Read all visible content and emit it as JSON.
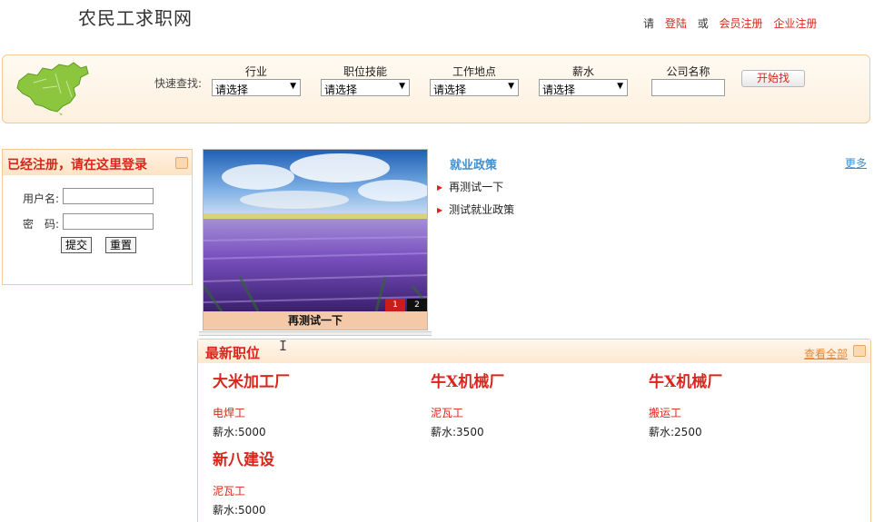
{
  "header": {
    "site_title": "农民工求职网",
    "prompt_text": "请",
    "login_link": "登陆",
    "or_text": "或",
    "member_register_link": "会员注册",
    "company_register_link": "企业注册"
  },
  "search": {
    "quick_label": "快速查找:",
    "fields": [
      {
        "label": "行业",
        "value": "请选择"
      },
      {
        "label": "职位技能",
        "value": "请选择"
      },
      {
        "label": "工作地点",
        "value": "请选择"
      },
      {
        "label": "薪水",
        "value": "请选择"
      }
    ],
    "company_label": "公司名称",
    "company_value": "",
    "button_label": "开始找"
  },
  "login": {
    "title": "已经注册，请在这里登录",
    "username_label": "用户名:",
    "password_label": "密　码:",
    "submit_label": "提交",
    "reset_label": "重置"
  },
  "slideshow": {
    "caption": "再测试一下",
    "pages": [
      "1",
      "2"
    ],
    "active_page": "1"
  },
  "policy": {
    "title": "就业政策",
    "more_label": "更多",
    "items": [
      "再测试一下",
      "测试就业政策"
    ]
  },
  "jobs": {
    "title": "最新职位",
    "more_label": "查看全部",
    "items": [
      {
        "company": "大米加工厂",
        "title": "电焊工",
        "salary": "薪水:5000"
      },
      {
        "company": "牛X机械厂",
        "title": "泥瓦工",
        "salary": "薪水:3500"
      },
      {
        "company": "牛X机械厂",
        "title": "搬运工",
        "salary": "薪水:2500"
      },
      {
        "company": "新八建设",
        "title": "泥瓦工",
        "salary": "薪水:5000"
      }
    ]
  },
  "colors": {
    "brand_red": "#d9261c",
    "link_blue": "#3f8fcf",
    "panel_border": "#f2c998"
  }
}
